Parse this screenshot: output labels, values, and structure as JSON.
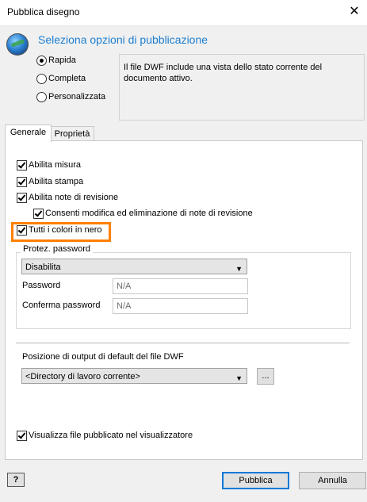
{
  "window": {
    "title": "Pubblica disegno",
    "close_glyph": "✕"
  },
  "header": {
    "icon": "globe-icon",
    "title": "Seleziona opzioni di pubblicazione"
  },
  "mode": {
    "options": [
      {
        "label": "Rapida",
        "checked": true
      },
      {
        "label": "Completa",
        "checked": false
      },
      {
        "label": "Personalizzata",
        "checked": false
      }
    ],
    "description": "Il file DWF include una vista dello stato corrente del documento attivo."
  },
  "tabs": [
    {
      "label": "Generale",
      "active": true
    },
    {
      "label": "Proprietà",
      "active": false
    }
  ],
  "options": {
    "enable_measure": "Abilita misura",
    "enable_print": "Abilita stampa",
    "enable_markup": "Abilita note di revisione",
    "allow_markup_edit": "Consenti modifica ed eliminazione di note di revisione",
    "all_black": "Tutti i colori in nero"
  },
  "password": {
    "legend": "Protez. password",
    "protection_value": "Disabilita",
    "password_label": "Password",
    "password_value": "N/A",
    "confirm_label": "Conferma password",
    "confirm_value": "N/A"
  },
  "output": {
    "label": "Posizione di output di default del file DWF",
    "value": "<Directory di lavoro corrente>",
    "browse_label": "..."
  },
  "view_in_viewer": "Visualizza file pubblicato nel visualizzatore",
  "buttons": {
    "help": "?",
    "publish": "Pubblica",
    "cancel": "Annulla"
  },
  "colors": {
    "accent": "#1d7fd3",
    "highlight": "#ff7f00",
    "primary_border": "#0078d7"
  }
}
